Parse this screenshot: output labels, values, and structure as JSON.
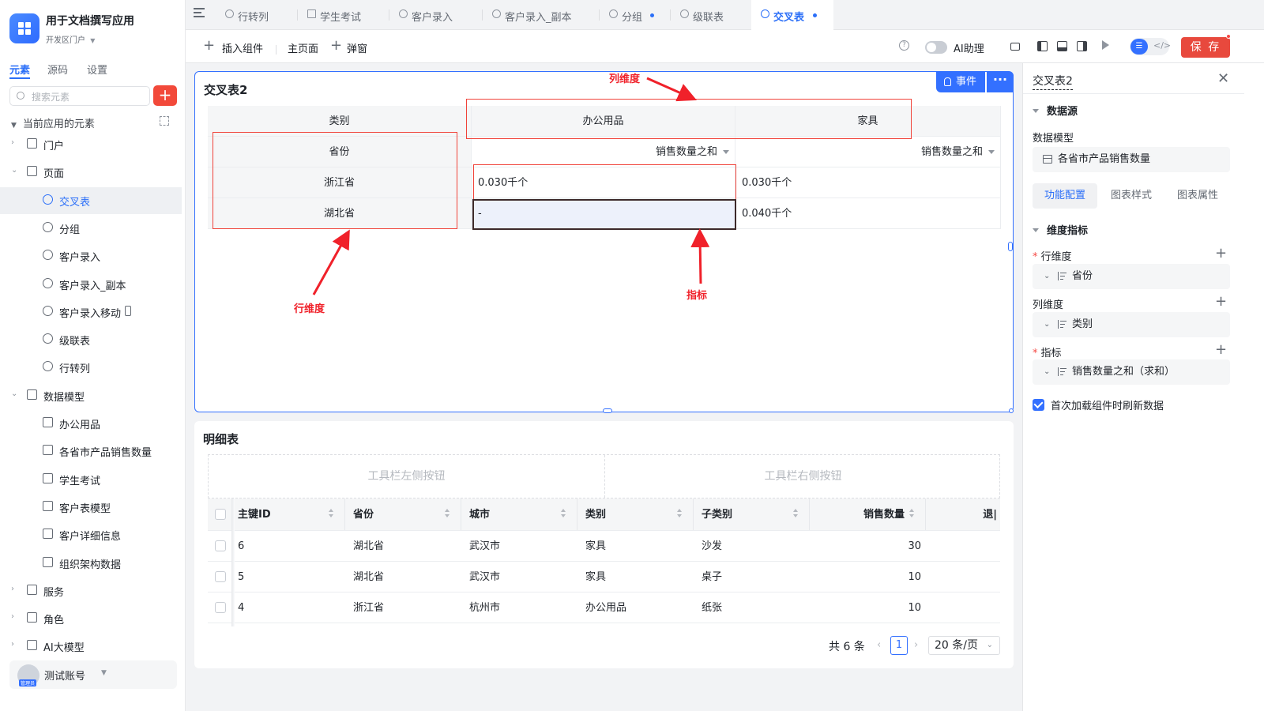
{
  "app": {
    "title": "用于文档撰写应用",
    "portal": "开发区门户"
  },
  "sidebar": {
    "tabs": [
      "元素",
      "源码",
      "设置"
    ],
    "search_placeholder": "搜索元素",
    "add_symbol": "+",
    "section_title": "当前应用的元素",
    "tree": [
      {
        "label": "门户",
        "icon": "home-icon",
        "level": 0,
        "caret": "›"
      },
      {
        "label": "页面",
        "icon": "page-icon",
        "level": 0,
        "caret": "⌄"
      },
      {
        "label": "交叉表",
        "icon": "chart-icon",
        "level": 1,
        "active": true
      },
      {
        "label": "分组",
        "icon": "chart-icon",
        "level": 1
      },
      {
        "label": "客户录入",
        "icon": "chart-icon",
        "level": 1
      },
      {
        "label": "客户录入_副本",
        "icon": "chart-icon",
        "level": 1
      },
      {
        "label": "客户录入移动",
        "icon": "chart-icon",
        "level": 1,
        "mobile": true
      },
      {
        "label": "级联表",
        "icon": "chart-icon",
        "level": 1
      },
      {
        "label": "行转列",
        "icon": "chart-icon",
        "level": 1
      },
      {
        "label": "数据模型",
        "icon": "table-icon",
        "level": 0,
        "caret": "⌄"
      },
      {
        "label": "办公用品",
        "icon": "table-icon",
        "level": 1
      },
      {
        "label": "各省市产品销售数量",
        "icon": "table-icon",
        "level": 1
      },
      {
        "label": "学生考试",
        "icon": "table-icon",
        "level": 1
      },
      {
        "label": "客户表模型",
        "icon": "table-icon",
        "level": 1
      },
      {
        "label": "客户详细信息",
        "icon": "table-icon",
        "level": 1
      },
      {
        "label": "组织架构数据",
        "icon": "table-icon",
        "level": 1
      },
      {
        "label": "服务",
        "icon": "service-icon",
        "level": 0,
        "caret": "›"
      },
      {
        "label": "角色",
        "icon": "role-icon",
        "level": 0,
        "caret": "›"
      },
      {
        "label": "AI大模型",
        "icon": "ai-icon",
        "level": 0,
        "caret": "›"
      }
    ],
    "user": {
      "name": "测试账号",
      "tag": "管理员"
    }
  },
  "tabs": [
    {
      "label": "行转列",
      "icon": "chart-icon"
    },
    {
      "label": "学生考试",
      "icon": "table-icon"
    },
    {
      "label": "客户录入",
      "icon": "chart-icon"
    },
    {
      "label": "客户录入_副本",
      "icon": "chart-icon"
    },
    {
      "label": "分组",
      "icon": "chart-icon",
      "dot": true
    },
    {
      "label": "级联表",
      "icon": "chart-icon"
    },
    {
      "label": "交叉表",
      "icon": "chart-icon",
      "dot": true,
      "active": true
    }
  ],
  "toolbar": {
    "insert_label": "插入组件",
    "main_page_label": "主页面",
    "popup_label": "弹窗",
    "help": "?",
    "ai_label": "AI助理",
    "save_label": "保 存"
  },
  "cross_table": {
    "title": "交叉表2",
    "event_label": "事件",
    "more_label": "···",
    "corner_col_header": "类别",
    "corner_row_header": "省份",
    "columns": [
      "办公用品",
      "家具"
    ],
    "measure_label": "销售数量之和",
    "rows": [
      {
        "province": "浙江省",
        "values": [
          "0.030千个",
          "0.030千个"
        ]
      },
      {
        "province": "湖北省",
        "values": [
          "-",
          "0.040千个"
        ]
      }
    ],
    "annotations": {
      "col_dim": "列维度",
      "row_dim": "行维度",
      "measure": "指标"
    }
  },
  "detail_table": {
    "title": "明细表",
    "toolbar_left": "工具栏左侧按钮",
    "toolbar_right": "工具栏右侧按钮",
    "columns": [
      "主键ID",
      "省份",
      "城市",
      "类别",
      "子类别",
      "销售数量",
      "退|"
    ],
    "rows": [
      [
        "6",
        "湖北省",
        "武汉市",
        "家具",
        "沙发",
        "30"
      ],
      [
        "5",
        "湖北省",
        "武汉市",
        "家具",
        "桌子",
        "10"
      ],
      [
        "4",
        "浙江省",
        "杭州市",
        "办公用品",
        "纸张",
        "10"
      ]
    ],
    "pager": {
      "total": "共 6 条",
      "prev": "‹",
      "page": "1",
      "next": "›",
      "size": "20 条/页"
    }
  },
  "panel": {
    "title": "交叉表2",
    "close": "✕",
    "datasource_section": "数据源",
    "data_model_label": "数据模型",
    "data_model_value": "各省市产品销售数量",
    "tabs": [
      "功能配置",
      "图表样式",
      "图表属性"
    ],
    "dims_section": "维度指标",
    "row_dim_label": "行维度",
    "row_dim_value": "省份",
    "col_dim_label": "列维度",
    "col_dim_value": "类别",
    "measure_label": "指标",
    "measure_value": "销售数量之和（求和）",
    "required_mark": "*",
    "add_symbol": "+",
    "refresh_label": "首次加载组件时刷新数据",
    "refresh_checked": true
  },
  "colors": {
    "accent": "#3370ff",
    "save": "#e8493d",
    "annotation": "#f0212a"
  }
}
